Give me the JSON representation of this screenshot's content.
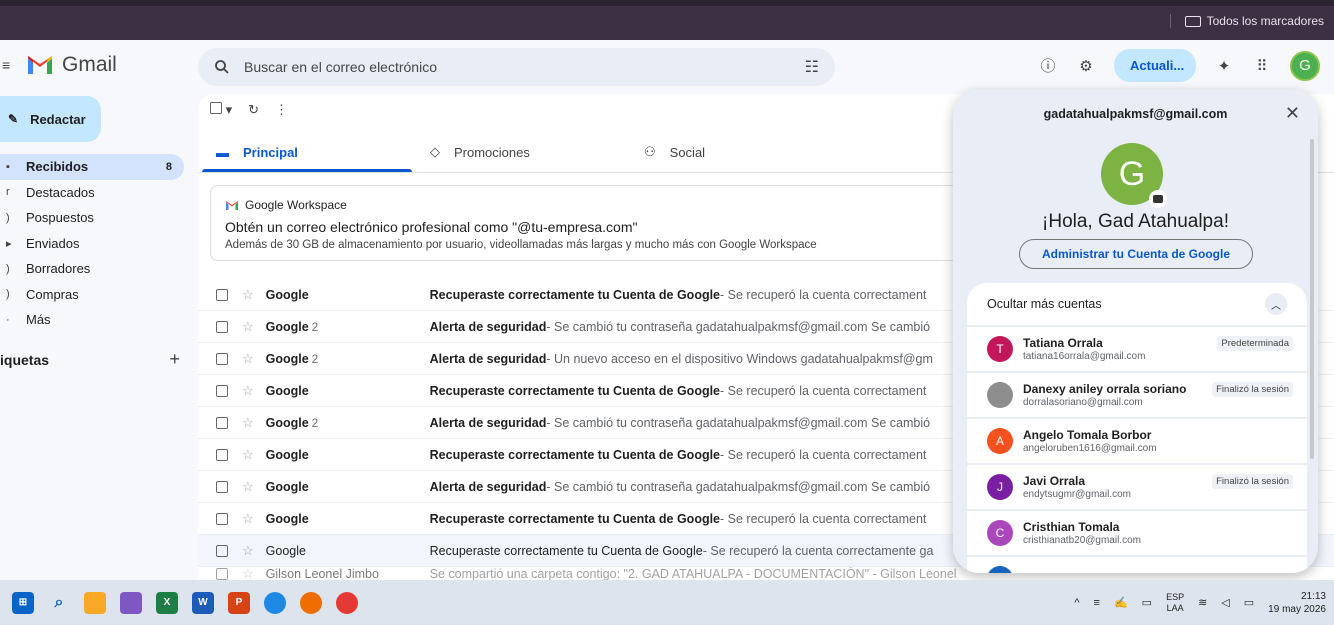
{
  "browser": {
    "bookmarks_label": "Todos los marcadores"
  },
  "header": {
    "app_name": "Gmail",
    "search_placeholder": "Buscar en el correo electrónico",
    "update_label": "Actuali...",
    "avatar_letter": "G"
  },
  "sidebar": {
    "compose_label": "Redactar",
    "items": [
      {
        "label": "Recibidos",
        "count": "8",
        "active": true
      },
      {
        "label": "Destacados"
      },
      {
        "label": "Pospuestos"
      },
      {
        "label": "Enviados"
      },
      {
        "label": "Borradores"
      },
      {
        "label": "Compras"
      },
      {
        "label": "Más"
      }
    ],
    "labels_title": "iquetas",
    "labels_add": "+"
  },
  "tabs": [
    {
      "label": "Principal",
      "active": true
    },
    {
      "label": "Promociones"
    },
    {
      "label": "Social"
    }
  ],
  "promo": {
    "brand": "Google Workspace",
    "title": "Obtén un correo electrónico profesional como \"@tu-empresa.com\"",
    "desc": "Además de 30 GB de almacenamiento por usuario, videollamadas más largas y mucho más con Google Workspace"
  },
  "emails": [
    {
      "sender": "Google",
      "count": "",
      "subject": "Recuperaste correctamente tu Cuenta de Google",
      "snippet": " - Se recuperó la cuenta correctament",
      "read": false
    },
    {
      "sender": "Google",
      "count": "2",
      "subject": "Alerta de seguridad",
      "snippet": " - Se cambió tu contraseña gadatahualpakmsf@gmail.com Se cambió",
      "read": false
    },
    {
      "sender": "Google",
      "count": "2",
      "subject": "Alerta de seguridad",
      "snippet": " - Un nuevo acceso en el dispositivo Windows gadatahualpakmsf@gm",
      "read": false
    },
    {
      "sender": "Google",
      "count": "",
      "subject": "Recuperaste correctamente tu Cuenta de Google",
      "snippet": " - Se recuperó la cuenta correctament",
      "read": false
    },
    {
      "sender": "Google",
      "count": "2",
      "subject": "Alerta de seguridad",
      "snippet": " - Se cambió tu contraseña gadatahualpakmsf@gmail.com Se cambió",
      "read": false
    },
    {
      "sender": "Google",
      "count": "",
      "subject": "Recuperaste correctamente tu Cuenta de Google",
      "snippet": " - Se recuperó la cuenta correctament",
      "read": false
    },
    {
      "sender": "Google",
      "count": "",
      "subject": "Alerta de seguridad",
      "snippet": " - Se cambió tu contraseña gadatahualpakmsf@gmail.com Se cambió",
      "read": false
    },
    {
      "sender": "Google",
      "count": "",
      "subject": "Recuperaste correctamente tu Cuenta de Google",
      "snippet": " - Se recuperó la cuenta correctament",
      "read": false
    },
    {
      "sender": "Google",
      "count": "",
      "subject": "Recuperaste correctamente tu Cuenta de Google",
      "snippet": " - Se recuperó la cuenta correctamente ga",
      "read": true
    }
  ],
  "partial_email": {
    "sender": "Gilson Leonel Jimbo",
    "text": "Se compartió una carpeta contigo: \"2. GAD ATAHUALPA - DOCUMENTACIÓN\" - Gilson Leonel"
  },
  "account_popup": {
    "email": "gadatahualpakmsf@gmail.com",
    "avatar_letter": "G",
    "greeting": "¡Hola, Gad Atahualpa!",
    "manage_label": "Administrar tu Cuenta de Google",
    "hide_label": "Ocultar más cuentas",
    "accounts": [
      {
        "initial": "T",
        "name": "Tatiana Orrala",
        "email": "tatiana16orrala@gmail.com",
        "badge": "Predeterminada",
        "color": "#c2185b"
      },
      {
        "initial": "",
        "name": "Danexy aniley orrala soriano",
        "email": "dorralasoriano@gmail.com",
        "badge": "Finalizó la sesión",
        "color": "#8d8d8d"
      },
      {
        "initial": "A",
        "name": "Angelo Tomala Borbor",
        "email": "angeloruben1616@gmail.com",
        "badge": "",
        "color": "#f4511e"
      },
      {
        "initial": "J",
        "name": "Javi Orrala",
        "email": "endytsugmr@gmail.com",
        "badge": "Finalizó la sesión",
        "color": "#7b1fa2"
      },
      {
        "initial": "C",
        "name": "Cristhian Tomala",
        "email": "cristhianatb20@gmail.com",
        "badge": "",
        "color": "#ab47bc"
      }
    ],
    "cut_name": "TATIANA ORRALA"
  },
  "taskbar": {
    "lang_top": "ESP",
    "lang_bottom": "LAA",
    "time": "21:13",
    "date": "19 may 2026"
  },
  "colors": {
    "accent": "#0b57d0",
    "compose_bg": "#c2e7ff",
    "active_nav": "#d3e3fd"
  }
}
